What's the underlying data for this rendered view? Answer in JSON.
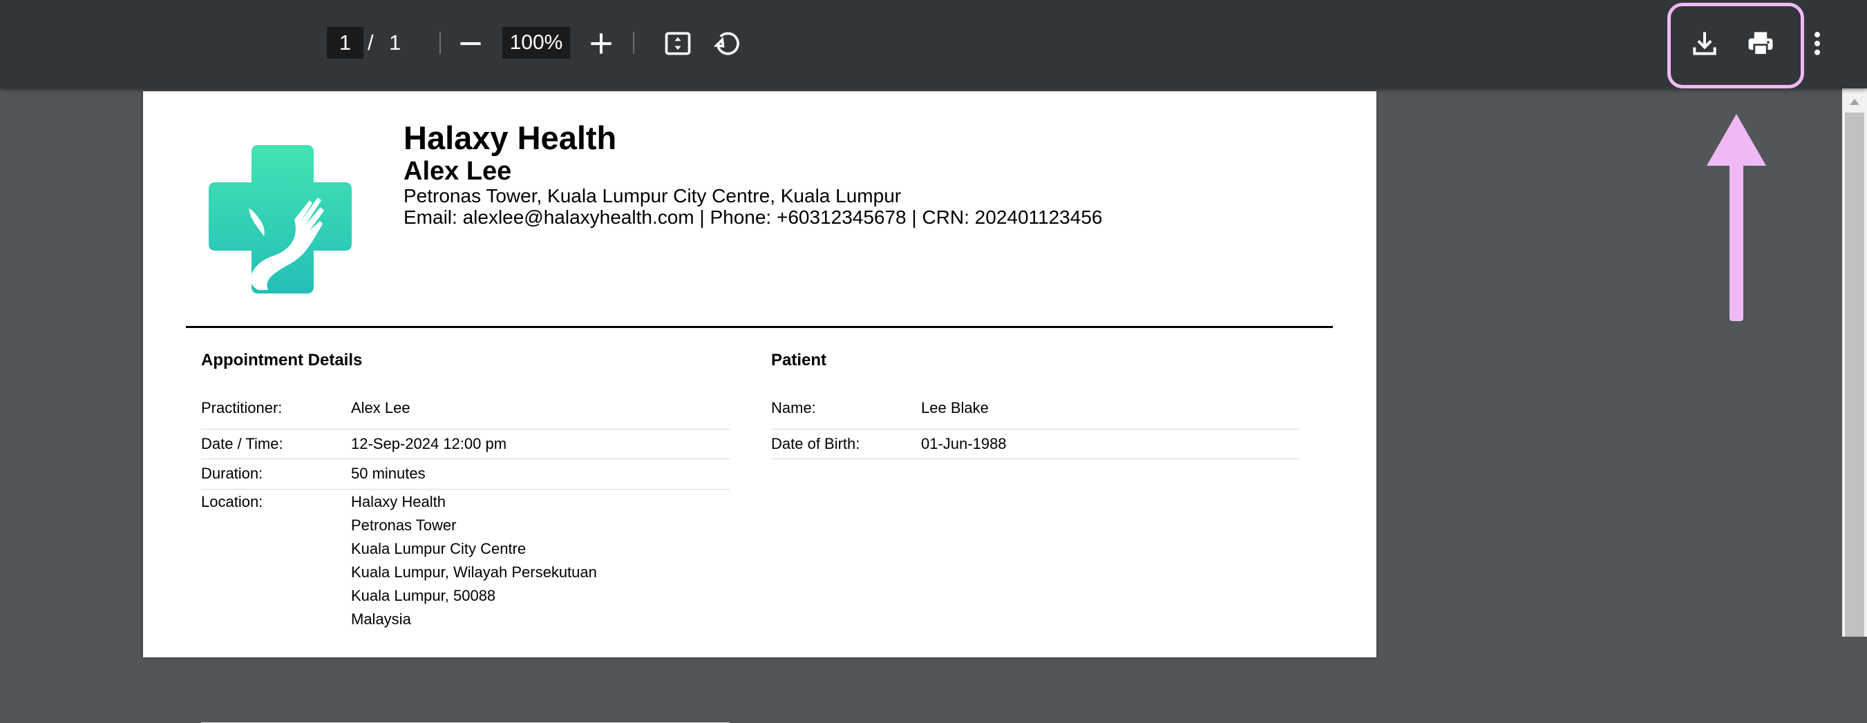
{
  "toolbar": {
    "current_page": "1",
    "page_separator": "/",
    "total_pages": "1",
    "zoom": "100%",
    "icons": [
      "minus-icon",
      "plus-icon",
      "fit-page-icon",
      "rotate-icon",
      "download-icon",
      "print-icon",
      "more-options-icon"
    ]
  },
  "annotation": {
    "highlight_color": "#f0b8f5"
  },
  "document": {
    "org_name": "Halaxy Health",
    "practitioner_name": "Alex Lee",
    "address": "Petronas Tower, Kuala Lumpur City Centre, Kuala Lumpur",
    "contact": "Email: alexlee@halaxyhealth.com | Phone: +60312345678 | CRN: 202401123456",
    "appointment": {
      "title": "Appointment Details",
      "rows": [
        {
          "label": "Practitioner:",
          "value": "Alex Lee"
        },
        {
          "label": "Date / Time:",
          "value": "12-Sep-2024 12:00 pm"
        },
        {
          "label": "Duration:",
          "value": "50 minutes"
        }
      ],
      "location_label": "Location:",
      "location_lines": [
        "Halaxy Health",
        "Petronas Tower",
        "Kuala Lumpur City Centre",
        "Kuala Lumpur, Wilayah Persekutuan",
        "Kuala Lumpur, 50088",
        "Malaysia"
      ]
    },
    "patient": {
      "title": "Patient",
      "rows": [
        {
          "label": "Name:",
          "value": "Lee Blake"
        },
        {
          "label": "Date of Birth:",
          "value": "01-Jun-1988"
        }
      ]
    }
  }
}
